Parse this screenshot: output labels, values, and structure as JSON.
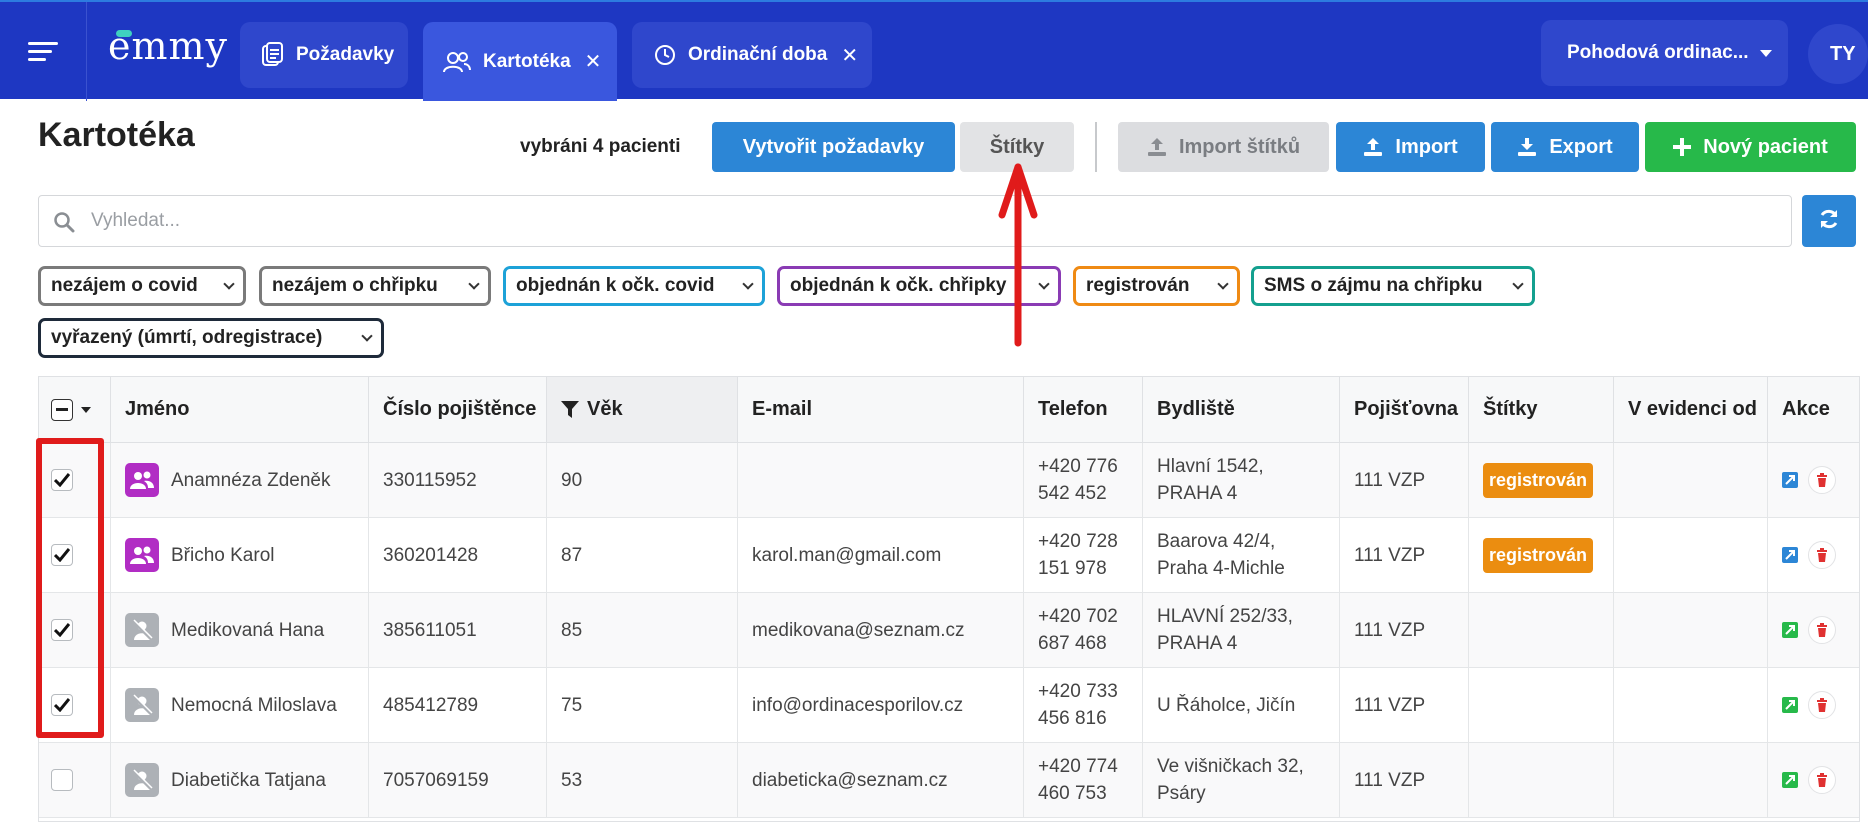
{
  "topbar": {
    "logo": "emmy",
    "tabs": [
      {
        "label": "Požadavky",
        "icon": "clipboard-icon",
        "closable": false,
        "active": false
      },
      {
        "label": "Kartotéka",
        "icon": "users-icon",
        "closable": true,
        "active": true
      },
      {
        "label": "Ordinační doba",
        "icon": "clock-icon",
        "closable": true,
        "active": false
      }
    ],
    "close_glyph": "✕",
    "org_selector": "Pohodová ordinac...",
    "avatar_initials": "TY"
  },
  "header": {
    "title": "Kartotéka",
    "selection_info": "vybráni 4 pacienti",
    "buttons": {
      "create_requests": "Vytvořit požadavky",
      "tags": "Štítky",
      "import_tags": "Import štítků",
      "import": "Import",
      "export": "Export",
      "new_patient": "Nový pacient"
    }
  },
  "search": {
    "placeholder": "Vyhledat..."
  },
  "filters": [
    {
      "label": "nezájem o covid",
      "color": "#7a7a7a"
    },
    {
      "label": "nezájem o chřipku",
      "color": "#7a7a7a"
    },
    {
      "label": "objednán k očk. covid",
      "color": "#1da2d8"
    },
    {
      "label": "objednán k očk. chřipky",
      "color": "#8a3bb4"
    },
    {
      "label": "registrován",
      "color": "#ef8a14"
    },
    {
      "label": "SMS o zájmu na chřipku",
      "color": "#14a08f"
    },
    {
      "label": "vyřazený (úmrtí, odregistrace)",
      "color": "#1e2a3a"
    }
  ],
  "table": {
    "columns": [
      "Jméno",
      "Číslo pojištěnce",
      "Věk",
      "E-mail",
      "Telefon",
      "Bydliště",
      "Pojišťovna",
      "Štítky",
      "V evidenci od",
      "Akce"
    ],
    "rows": [
      {
        "checked": true,
        "avatar": "purple",
        "name": "Anamnéza Zdeněk",
        "insurance_no": "330115952",
        "age": "90",
        "email": "",
        "phone_1": "+420 776",
        "phone_2": "542 452",
        "address_1": "Hlavní 1542,",
        "address_2": "PRAHA 4",
        "insurer": "111 VZP",
        "tag": "registrován",
        "since": ""
      },
      {
        "checked": true,
        "avatar": "purple",
        "name": "Břicho Karol",
        "insurance_no": "360201428",
        "age": "87",
        "email": "karol.man@gmail.com",
        "phone_1": "+420 728",
        "phone_2": "151 978",
        "address_1": "Baarova 42/4,",
        "address_2": "Praha 4-Michle",
        "insurer": "111 VZP",
        "tag": "registrován",
        "since": ""
      },
      {
        "checked": true,
        "avatar": "gray",
        "name": "Medikovaná Hana",
        "insurance_no": "385611051",
        "age": "85",
        "email": "medikovana@seznam.cz",
        "phone_1": "+420 702",
        "phone_2": "687 468",
        "address_1": "HLAVNÍ 252/33,",
        "address_2": "PRAHA 4",
        "insurer": "111 VZP",
        "tag": "",
        "since": ""
      },
      {
        "checked": true,
        "avatar": "gray",
        "name": "Nemocná Miloslava",
        "insurance_no": "485412789",
        "age": "75",
        "email": "info@ordinacesporilov.cz",
        "phone_1": "+420 733",
        "phone_2": "456 816",
        "address_1": "U Řáholce, Jičín",
        "address_2": "",
        "insurer": "111 VZP",
        "tag": "",
        "since": ""
      },
      {
        "checked": false,
        "avatar": "gray",
        "name": "Diabetička Tatjana",
        "insurance_no": "7057069159",
        "age": "53",
        "email": "diabeticka@seznam.cz",
        "phone_1": "+420 774",
        "phone_2": "460 753",
        "address_1": "Ve višničkach 32,",
        "address_2": "Psáry",
        "insurer": "111 VZP",
        "tag": "",
        "since": ""
      }
    ]
  },
  "colors": {
    "topbar": "#1e37c2",
    "primary": "#2c86d6",
    "success": "#27b94a",
    "tag_registered": "#eb8d10",
    "annotation": "#e01b1b"
  }
}
